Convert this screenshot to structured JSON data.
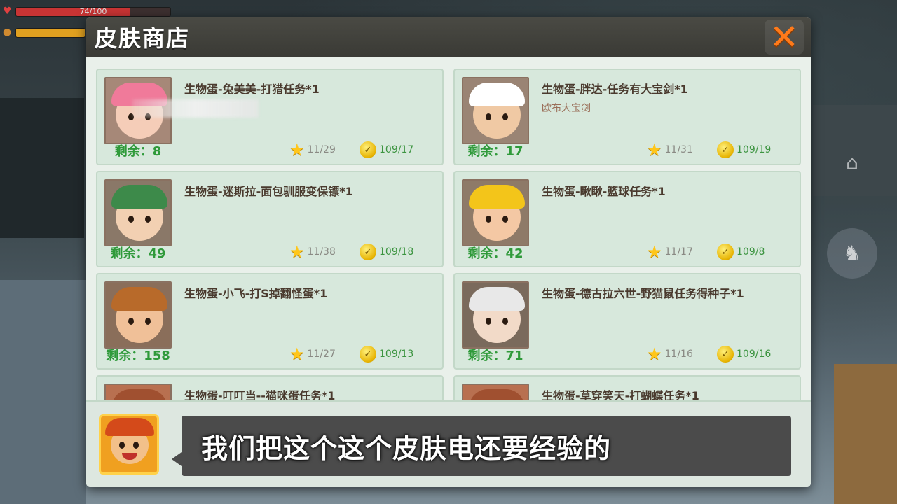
{
  "hud": {
    "health_label": "74/100",
    "health_fraction": 0.74
  },
  "shop": {
    "title": "皮肤商店",
    "close_label": "✕",
    "items": [
      {
        "name": "生物蛋-兔美美-打猎任务*1",
        "subtitle": "",
        "stock_label": "剩余：8",
        "star_cost": "11/29",
        "coin_cost": "109/17",
        "portrait": "pink-bunny-girl"
      },
      {
        "name": "生物蛋-胖达-任务有大宝剑*1",
        "subtitle": "欧布大宝剑",
        "stock_label": "剩余：17",
        "star_cost": "11/31",
        "coin_cost": "109/19",
        "portrait": "panda-hood-boy"
      },
      {
        "name": "生物蛋-迷斯拉-面包驯服变保镖*1",
        "subtitle": "",
        "stock_label": "剩余：49",
        "star_cost": "11/38",
        "coin_cost": "109/18",
        "portrait": "dinosaur-hood-kid"
      },
      {
        "name": "生物蛋-瞅瞅-篮球任务*1",
        "subtitle": "",
        "stock_label": "剩余：42",
        "star_cost": "11/17",
        "coin_cost": "109/8",
        "portrait": "yellow-chick-costume"
      },
      {
        "name": "生物蛋-小飞-打S掉翻怪蛋*1",
        "subtitle": "",
        "stock_label": "剩余：158",
        "star_cost": "11/27",
        "coin_cost": "109/13",
        "portrait": "monkey-kid"
      },
      {
        "name": "生物蛋-德古拉六世-野猫鼠任务得种子*1",
        "subtitle": "",
        "stock_label": "剩余：71",
        "star_cost": "11/16",
        "coin_cost": "109/16",
        "portrait": "vampire"
      },
      {
        "name": "生物蛋-叮叮当--猫咪蛋任务*1",
        "subtitle": "",
        "stock_label": "",
        "star_cost": "",
        "coin_cost": "",
        "portrait": "partial"
      },
      {
        "name": "生物蛋-草穿笑天-打蝴蝶任务*1",
        "subtitle": "",
        "stock_label": "",
        "star_cost": "",
        "coin_cost": "",
        "portrait": "partial"
      }
    ]
  },
  "dialogue": {
    "subtitle": "我们把这个这个皮肤电还要经验的",
    "speaker_icon": "monkey-king-avatar"
  }
}
